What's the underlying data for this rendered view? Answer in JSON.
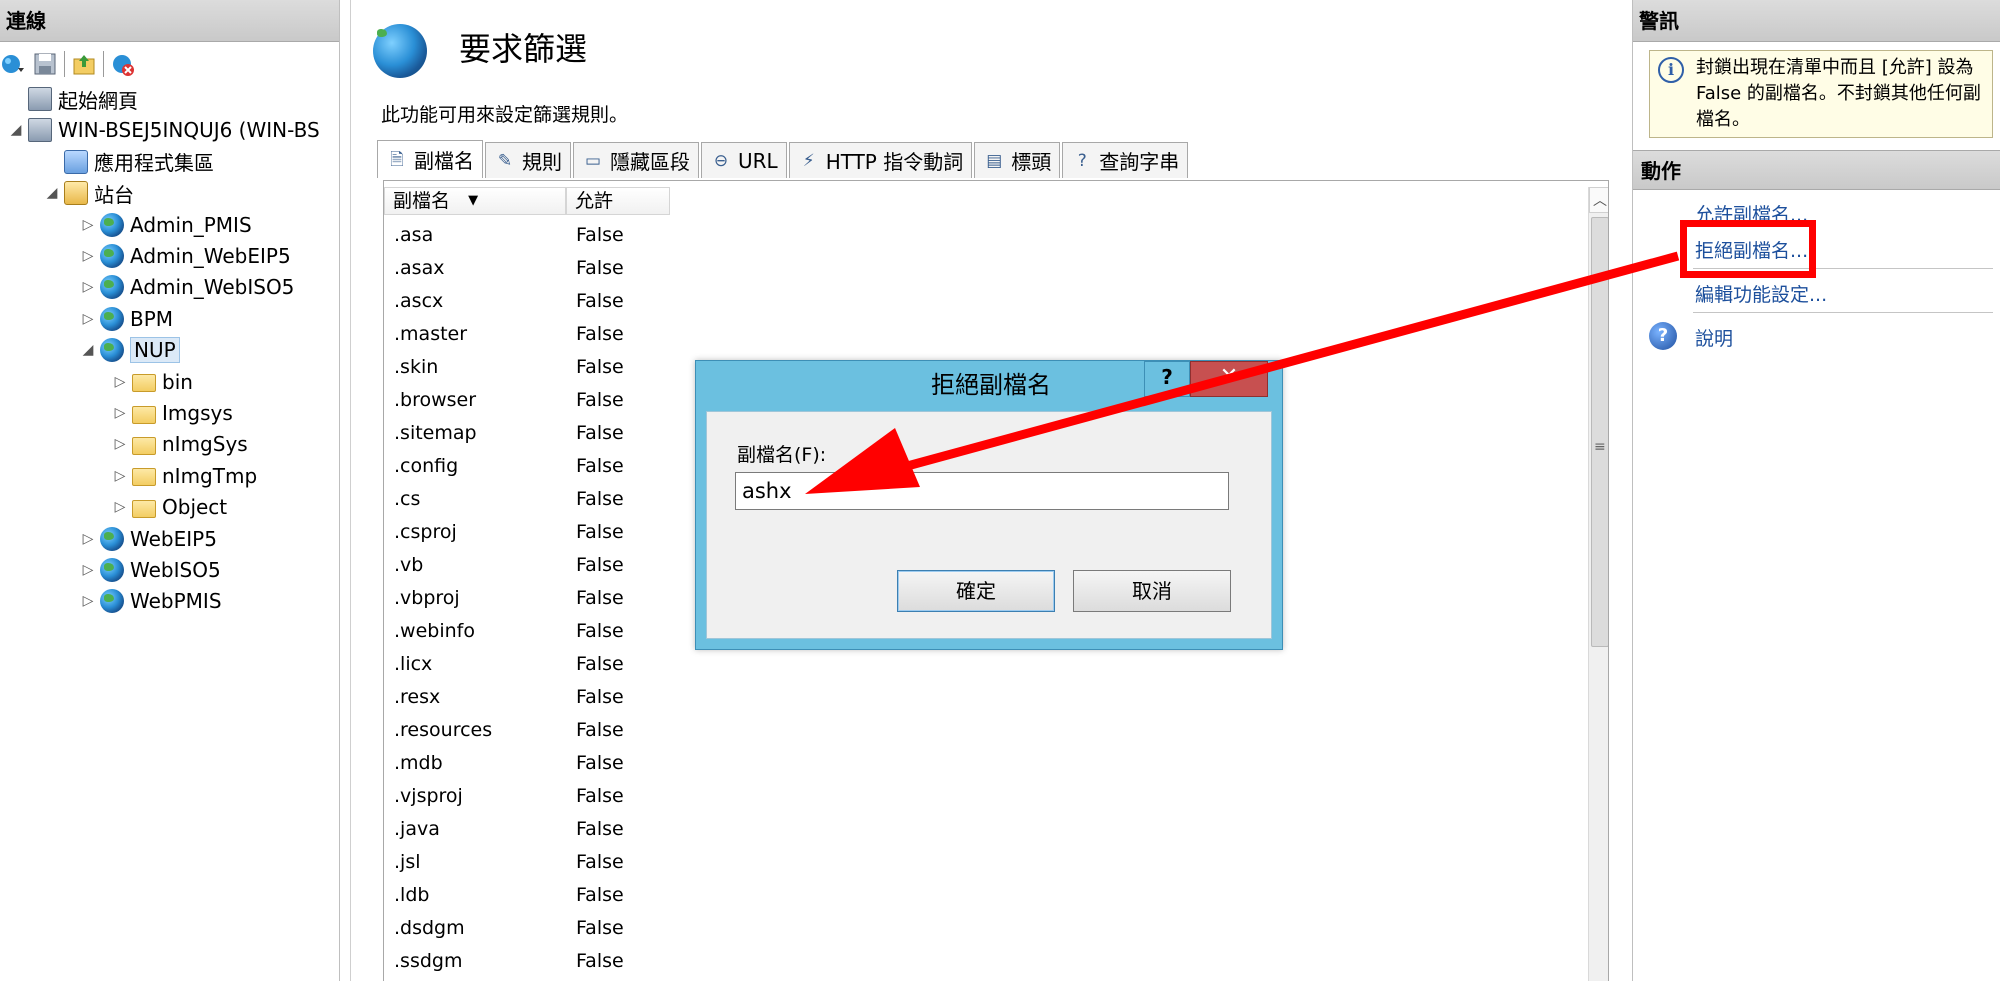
{
  "connections": {
    "header": "連線",
    "tree": [
      {
        "label": "起始網頁",
        "icon": "server-icon",
        "level": 0,
        "expander": ""
      },
      {
        "label": "WIN-BSEJ5INQUJ6 (WIN-BS",
        "icon": "server-icon",
        "level": 0,
        "expander": "◢"
      },
      {
        "label": "應用程式集區",
        "icon": "app-pool-icon",
        "level": 1,
        "expander": ""
      },
      {
        "label": "站台",
        "icon": "sites-icon",
        "level": 1,
        "expander": "◢"
      },
      {
        "label": "Admin_PMIS",
        "icon": "globe-icon",
        "level": 2,
        "expander": "▷"
      },
      {
        "label": "Admin_WebEIP5",
        "icon": "globe-icon",
        "level": 2,
        "expander": "▷"
      },
      {
        "label": "Admin_WebISO5",
        "icon": "globe-icon",
        "level": 2,
        "expander": "▷"
      },
      {
        "label": "BPM",
        "icon": "globe-icon",
        "level": 2,
        "expander": "▷"
      },
      {
        "label": "NUP",
        "icon": "globe-icon",
        "level": 2,
        "expander": "◢",
        "selected": true
      },
      {
        "label": "bin",
        "icon": "folder-icon",
        "level": 3,
        "expander": "▷"
      },
      {
        "label": "Imgsys",
        "icon": "folder-icon",
        "level": 3,
        "expander": "▷"
      },
      {
        "label": "nImgSys",
        "icon": "folder-icon",
        "level": 3,
        "expander": "▷"
      },
      {
        "label": "nImgTmp",
        "icon": "folder-icon",
        "level": 3,
        "expander": "▷"
      },
      {
        "label": "Object",
        "icon": "folder-icon",
        "level": 3,
        "expander": "▷"
      },
      {
        "label": "WebEIP5",
        "icon": "globe-icon",
        "level": 2,
        "expander": "▷"
      },
      {
        "label": "WebISO5",
        "icon": "globe-icon",
        "level": 2,
        "expander": "▷"
      },
      {
        "label": "WebPMIS",
        "icon": "globe-icon",
        "level": 2,
        "expander": "▷"
      }
    ]
  },
  "feature": {
    "title": "要求篩選",
    "description": "此功能可用來設定篩選規則。",
    "tabs": [
      {
        "label": "副檔名",
        "icon": "extension-icon",
        "active": true
      },
      {
        "label": "規則",
        "icon": "rules-icon"
      },
      {
        "label": "隱藏區段",
        "icon": "hidden-segments-icon"
      },
      {
        "label": "URL",
        "icon": "url-icon"
      },
      {
        "label": "HTTP 指令動詞",
        "icon": "http-verb-icon"
      },
      {
        "label": "標頭",
        "icon": "headers-icon"
      },
      {
        "label": "查詢字串",
        "icon": "query-string-icon"
      }
    ],
    "columns": [
      "副檔名",
      "允許"
    ],
    "sort_indicator": "▼",
    "rows": [
      [
        ".asa",
        "False"
      ],
      [
        ".asax",
        "False"
      ],
      [
        ".ascx",
        "False"
      ],
      [
        ".master",
        "False"
      ],
      [
        ".skin",
        "False"
      ],
      [
        ".browser",
        "False"
      ],
      [
        ".sitemap",
        "False"
      ],
      [
        ".config",
        "False"
      ],
      [
        ".cs",
        "False"
      ],
      [
        ".csproj",
        "False"
      ],
      [
        ".vb",
        "False"
      ],
      [
        ".vbproj",
        "False"
      ],
      [
        ".webinfo",
        "False"
      ],
      [
        ".licx",
        "False"
      ],
      [
        ".resx",
        "False"
      ],
      [
        ".resources",
        "False"
      ],
      [
        ".mdb",
        "False"
      ],
      [
        ".vjsproj",
        "False"
      ],
      [
        ".java",
        "False"
      ],
      [
        ".jsl",
        "False"
      ],
      [
        ".ldb",
        "False"
      ],
      [
        ".dsdgm",
        "False"
      ],
      [
        ".ssdgm",
        "False"
      ]
    ]
  },
  "alerts": {
    "header": "警訊",
    "message": "封鎖出現在清單中而且 [允許] 設為 False 的副檔名。不封鎖其他任何副檔名。"
  },
  "actions": {
    "header": "動作",
    "items": [
      "允許副檔名...",
      "拒絕副檔名...",
      "編輯功能設定..."
    ],
    "help": "說明"
  },
  "dialog": {
    "title": "拒絕副檔名",
    "help_glyph": "?",
    "close_glyph": "✕",
    "field_label": "副檔名(F):",
    "field_value": "ashx",
    "ok": "確定",
    "cancel": "取消"
  },
  "colors": {
    "highlight": "#ff0000",
    "link": "#1c4f9c",
    "dialog_frame": "#6bc0e0",
    "close_button": "#c75050"
  }
}
